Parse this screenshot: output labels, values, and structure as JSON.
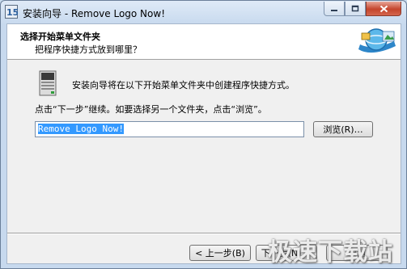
{
  "window": {
    "title": "安装向导 - Remove Logo Now!",
    "app_icon": "installer-icon"
  },
  "header": {
    "title": "选择开始菜单文件夹",
    "subtitle": "把程序快捷方式放到哪里？"
  },
  "body": {
    "description": "安装向导将在以下开始菜单文件夹中创建程序快捷方式。",
    "instruction": "点击“下一步”继续。如要选择另一个文件夹，点击“浏览”。",
    "folder_value": "Remove Logo Now!",
    "browse_label": "浏览(R)…"
  },
  "footer": {
    "back_label": "< 上一步(B)",
    "next_label": "下一步(N) >",
    "cancel_label": "取消"
  },
  "watermark": "极速下载站"
}
